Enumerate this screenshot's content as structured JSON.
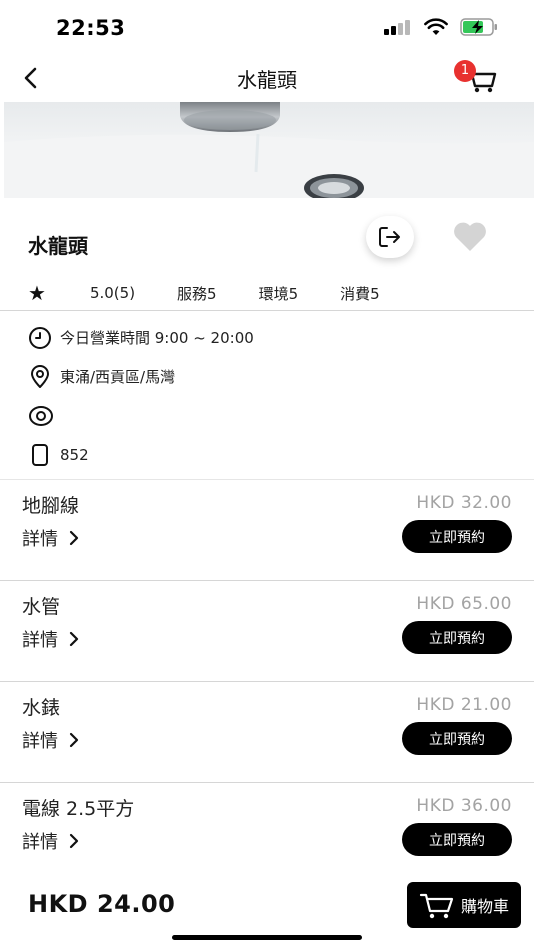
{
  "status_bar": {
    "time": "22:53"
  },
  "nav": {
    "title": "水龍頭",
    "cart_count": "1"
  },
  "shop": {
    "name": "水龍頭",
    "rating": "5.0(5)",
    "service_score": "服務5",
    "environment_score": "環境5",
    "spending_score": "消費5",
    "hours": "今日營業時間 9:00 ~ 20:00",
    "address": "東涌/西貢區/馬灣",
    "phone": "852"
  },
  "services": [
    {
      "name": "地腳線",
      "price": "HKD 32.00",
      "detail_label": "詳情",
      "book_label": "立即預約"
    },
    {
      "name": "水管",
      "price": "HKD 65.00",
      "detail_label": "詳情",
      "book_label": "立即預約"
    },
    {
      "name": "水錶",
      "price": "HKD 21.00",
      "detail_label": "詳情",
      "book_label": "立即預約"
    },
    {
      "name": "電線 2.5平方",
      "price": "HKD 36.00",
      "detail_label": "詳情",
      "book_label": "立即預約"
    }
  ],
  "footer": {
    "total": "HKD 24.00",
    "cart_label": "購物車"
  },
  "colors": {
    "accent": "#000000",
    "badge": "#e8312f",
    "price": "#a3a3a3",
    "battery": "#34c759"
  },
  "icons": [
    "back-icon",
    "cart-icon",
    "share-icon",
    "heart-icon",
    "star-icon",
    "clock-icon",
    "location-icon",
    "eye-icon",
    "phone-icon",
    "chevron-right-icon"
  ]
}
